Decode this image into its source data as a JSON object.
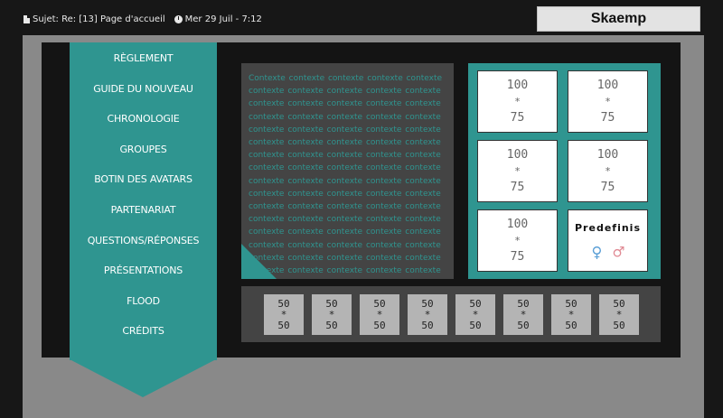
{
  "topbar": {
    "subject": "Sujet: Re: [13] Page d'accueil",
    "date": "Mer 29 Juil - 7:12",
    "username": "Skaemp"
  },
  "nav": {
    "items": [
      "RÈGLEMENT",
      "GUIDE DU NOUVEAU",
      "CHRONOLOGIE",
      "GROUPES",
      "BOTIN DES AVATARS",
      "PARTENARIAT",
      "QUESTIONS/RÉPONSES",
      "PRÉSENTATIONS",
      "FLOOD",
      "CRÉDITS"
    ]
  },
  "context": {
    "word": "contexte",
    "first_word": "Contexte",
    "rows": 16,
    "words_per_row": 5
  },
  "avatars": {
    "items": [
      {
        "w": "100",
        "sep": "*",
        "h": "75"
      },
      {
        "w": "100",
        "sep": "*",
        "h": "75"
      },
      {
        "w": "100",
        "sep": "*",
        "h": "75"
      },
      {
        "w": "100",
        "sep": "*",
        "h": "75"
      },
      {
        "w": "100",
        "sep": "*",
        "h": "75"
      }
    ],
    "predefined": {
      "title": "Predefinis",
      "female": "♀",
      "male": "♂"
    }
  },
  "strip": {
    "items": [
      {
        "w": "50",
        "sep": "*",
        "h": "50"
      },
      {
        "w": "50",
        "sep": "*",
        "h": "50"
      },
      {
        "w": "50",
        "sep": "*",
        "h": "50"
      },
      {
        "w": "50",
        "sep": "*",
        "h": "50"
      },
      {
        "w": "50",
        "sep": "*",
        "h": "50"
      },
      {
        "w": "50",
        "sep": "*",
        "h": "50"
      },
      {
        "w": "50",
        "sep": "*",
        "h": "50"
      },
      {
        "w": "50",
        "sep": "*",
        "h": "50"
      }
    ]
  },
  "colors": {
    "accent": "#2f9590",
    "background": "#171717",
    "frame": "#898989",
    "panel": "#141414",
    "box": "#444444"
  }
}
